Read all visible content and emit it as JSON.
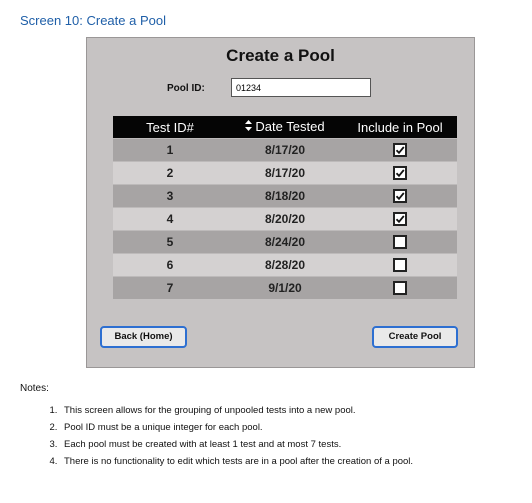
{
  "screen_title": "Screen 10: Create a Pool",
  "panel_title": "Create a Pool",
  "pool_id": {
    "label": "Pool ID:",
    "value": "01234"
  },
  "table": {
    "headers": {
      "test_id": "Test ID#",
      "date_tested": "Date Tested",
      "include": "Include in Pool"
    },
    "rows": [
      {
        "id": "1",
        "date": "8/17/20",
        "included": true
      },
      {
        "id": "2",
        "date": "8/17/20",
        "included": true
      },
      {
        "id": "3",
        "date": "8/18/20",
        "included": true
      },
      {
        "id": "4",
        "date": "8/20/20",
        "included": true
      },
      {
        "id": "5",
        "date": "8/24/20",
        "included": false
      },
      {
        "id": "6",
        "date": "8/28/20",
        "included": false
      },
      {
        "id": "7",
        "date": "9/1/20",
        "included": false
      }
    ]
  },
  "buttons": {
    "back": "Back (Home)",
    "create": "Create Pool"
  },
  "notes": {
    "label": "Notes:",
    "items": [
      "This screen allows for the grouping of unpooled tests into a new pool.",
      "Pool ID must be a unique integer for each pool.",
      "Each pool must be created with at least 1 test and at most 7 tests.",
      "There is no functionality to edit which tests are in a pool after the creation of a pool."
    ]
  },
  "icons": {
    "sort": "sort-icon",
    "checkbox": "checkbox"
  },
  "colors": {
    "title_blue": "#1f5fa8",
    "button_border": "#2d6fd1",
    "panel_bg": "#c6c3c3",
    "header_bg": "#050505"
  }
}
